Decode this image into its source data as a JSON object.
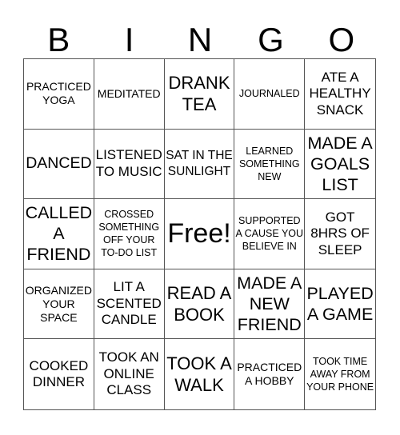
{
  "header": {
    "letters": [
      "B",
      "I",
      "N",
      "G",
      "O"
    ]
  },
  "cells": [
    "PRACTICED YOGA",
    "MEDITATED",
    "DRANK TEA",
    "JOURNALED",
    "ATE A HEALTHY SNACK",
    "DANCED",
    "LISTENED TO MUSIC",
    "SAT IN THE SUNLIGHT",
    "LEARNED SOMETHING NEW",
    "MADE A GOALS LIST",
    "CALLED A FRIEND",
    "CROSSED SOMETHING OFF YOUR TO-DO LIST",
    "Free!",
    "SUPPORTED A CAUSE YOU BELIEVE IN",
    "GOT 8HRS OF SLEEP",
    "ORGANIZED YOUR SPACE",
    "LIT A SCENTED CANDLE",
    "READ A BOOK",
    "MADE A NEW FRIEND",
    "PLAYED A GAME",
    "COOKED DINNER",
    "TOOK AN ONLINE CLASS",
    "TOOK A WALK",
    "PRACTICED A HOBBY",
    "TOOK TIME AWAY FROM YOUR PHONE"
  ]
}
